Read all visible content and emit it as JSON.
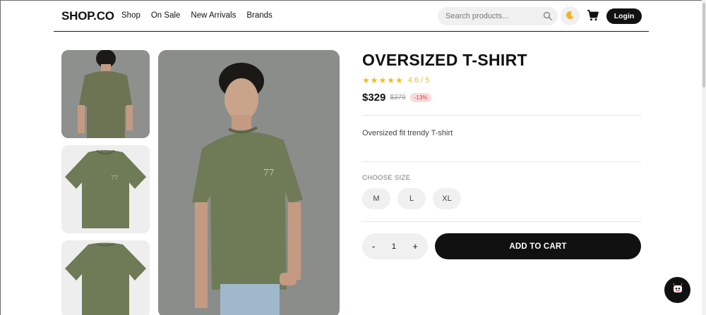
{
  "nav": {
    "logo": "SHOP.CO",
    "links": [
      "Shop",
      "On Sale",
      "New Arrivals",
      "Brands"
    ],
    "search_placeholder": "Search products...",
    "login_label": "Login",
    "icons": [
      "search-icon",
      "moon-icon",
      "cart-icon"
    ]
  },
  "product": {
    "title": "OVERSIZED T-SHIRT",
    "stars": "★★★★★",
    "rating_text": "4.6 / 5",
    "price": "$329",
    "old_price": "$379",
    "discount": "-13%",
    "description": "Oversized fit trendy T-shirt",
    "size_label": "CHOOSE SIZE",
    "sizes": [
      "M",
      "L",
      "XL"
    ],
    "quantity": {
      "minus": "-",
      "value": "1",
      "plus": "+"
    },
    "add_to_cart_label": "ADD TO CART"
  },
  "colors": {
    "accent": "#111111",
    "star": "#f5b81c",
    "discount": "#e23b3b",
    "shirt": "#6f7a57"
  }
}
